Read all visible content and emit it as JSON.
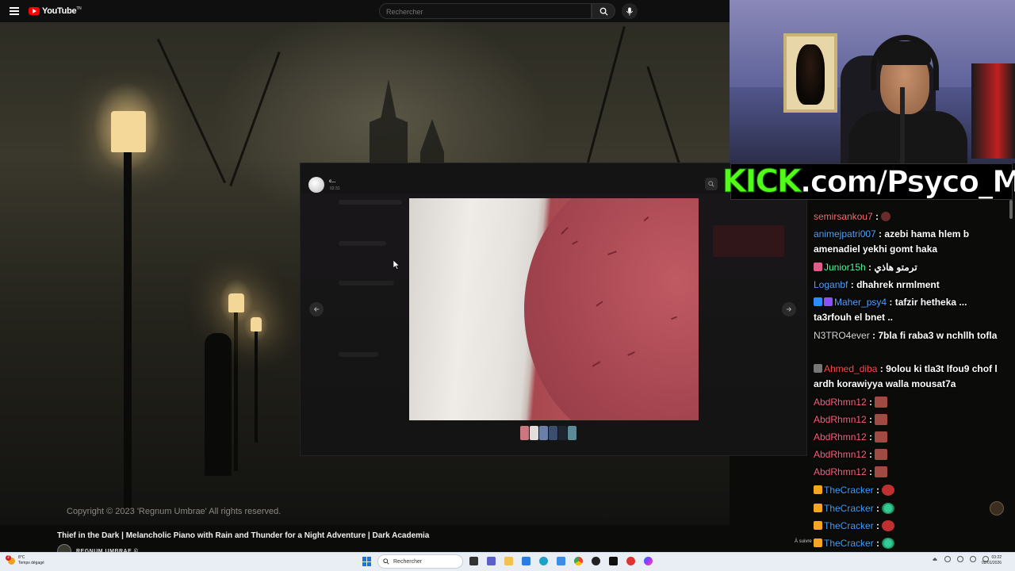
{
  "youtube": {
    "logo_text": "YouTube",
    "logo_sup": "TN",
    "search_placeholder": "Rechercher",
    "video_copyright": "Copyright © 2023 'Regnum Umbrae' All rights reserved.",
    "video_title": "Thief in the Dark | Melancholic Piano with Rain and Thunder for a Night Adventure | Dark Academia",
    "channel_name": "REGNUM UMBRAE ©",
    "icons": [
      "menu-icon",
      "search-icon",
      "microphone-icon",
      "youtube-logo-icon"
    ]
  },
  "viewer": {
    "sender": "c...",
    "time": "02:31",
    "icons": [
      "zoom-icon",
      "share-icon",
      "arrow-left-icon",
      "arrow-right-icon"
    ],
    "thumbnail_colors": [
      "#c9787f",
      "#e2dedb",
      "#6b7fa8",
      "#3d4d6e",
      "#1e2430",
      "#5c8b97"
    ]
  },
  "kick": {
    "brand": "KICK",
    "rest": ".com/Psyco_M",
    "brand_color": "#53fc18"
  },
  "chat": {
    "messages": [
      {
        "user": "semirsankou7",
        "user_color": "#ff6b6b",
        "text": "",
        "emote": "small"
      },
      {
        "user": "animejpatri007",
        "user_color": "#4fa3ff",
        "text": "azebi hama hlem b amenadiel yekhi gomt haka"
      },
      {
        "user": "Junior15h",
        "user_color": "#4cff9a",
        "text": "ترمتو هاذي",
        "badge": "#e05c8a"
      },
      {
        "user": "Loganbf",
        "user_color": "#4fa3ff",
        "text": "dhahrek nrmlment"
      },
      {
        "user": "Maher_psy4",
        "user_color": "#4fa3ff",
        "text": "tafzir hetheka ... ta3rfouh el bnet ..",
        "badge": "#2a8cff",
        "badge2": "#8a4fff"
      },
      {
        "user": "N3TRO4ever",
        "user_color": "#d8d8d8",
        "text": "7bla fi raba3 w nchllh tofla"
      },
      {
        "user": "Ahmed_diba",
        "user_color": "#ff4d4d",
        "text": "9olou ki tla3t lfou9 chof l ardh korawiyya walla mousat7a",
        "badge": "#777"
      },
      {
        "user": "AbdRhmn12",
        "user_color": "#ff5e7a",
        "text": "",
        "emote": "box"
      },
      {
        "user": "AbdRhmn12",
        "user_color": "#ff5e7a",
        "text": "",
        "emote": "box"
      },
      {
        "user": "AbdRhmn12",
        "user_color": "#ff5e7a",
        "text": "",
        "emote": "box"
      },
      {
        "user": "AbdRhmn12",
        "user_color": "#ff5e7a",
        "text": "",
        "emote": "box"
      },
      {
        "user": "AbdRhmn12",
        "user_color": "#ff5e7a",
        "text": "",
        "emote": "box"
      },
      {
        "user": "TheCracker",
        "user_color": "#3aa0ff",
        "text": "",
        "emote": "red",
        "badge": "#f5a623"
      },
      {
        "user": "TheCracker",
        "user_color": "#3aa0ff",
        "text": "",
        "emote": "green",
        "badge": "#f5a623"
      },
      {
        "user": "TheCracker",
        "user_color": "#3aa0ff",
        "text": "",
        "emote": "red",
        "badge": "#f5a623"
      },
      {
        "user": "TheCracker",
        "user_color": "#3aa0ff",
        "text": "",
        "emote": "green",
        "badge": "#f5a623"
      },
      {
        "user": "TheCracker",
        "user_color": "#3aa0ff",
        "text": "",
        "emote": "red",
        "badge": "#f5a623"
      }
    ]
  },
  "notification_chip": "À suivre",
  "taskbar": {
    "weather_temp": "8°C",
    "weather_desc": "Temps dégagé",
    "weather_badge": "2",
    "search_label": "Rechercher",
    "time": "03:22",
    "date": "02/01/2026",
    "icons": [
      "windows-start-icon",
      "search-icon",
      "wifi-icon",
      "volume-icon",
      "battery-icon"
    ]
  }
}
